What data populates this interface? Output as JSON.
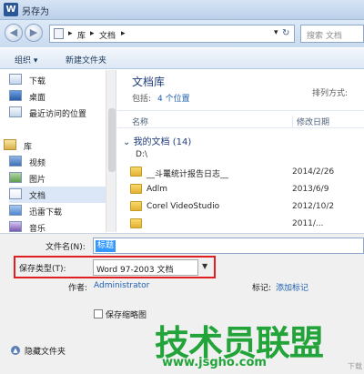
{
  "window": {
    "title": "另存为",
    "app_icon_letter": "W"
  },
  "nav": {
    "back_glyph": "◀",
    "forward_glyph": "▶",
    "breadcrumbs": [
      "库",
      "文档"
    ],
    "refresh_glyph": "↻",
    "search_placeholder": "搜索 文档"
  },
  "toolbar": {
    "organize_label": "组织 ▾",
    "new_folder_label": "新建文件夹"
  },
  "sidebar": {
    "items": [
      {
        "label": "下载",
        "icon": "download-icon"
      },
      {
        "label": "桌面",
        "icon": "desktop-icon"
      },
      {
        "label": "最近访问的位置",
        "icon": "recent-icon"
      },
      {
        "label": "库",
        "icon": "library-icon"
      },
      {
        "label": "视频",
        "icon": "video-icon"
      },
      {
        "label": "图片",
        "icon": "picture-icon"
      },
      {
        "label": "文档",
        "icon": "documents-icon",
        "selected": true
      },
      {
        "label": "迅雷下载",
        "icon": "thunder-icon"
      },
      {
        "label": "音乐",
        "icon": "music-icon"
      }
    ]
  },
  "library": {
    "title": "文档库",
    "includes_label": "包括:",
    "includes_link": "4 个位置",
    "arrange_label": "排列方式:"
  },
  "columns": {
    "name": "名称",
    "date": "修改日期"
  },
  "group": {
    "header": "我的文档 (14)",
    "path": "D:\\"
  },
  "files": [
    {
      "name": "__斗鼍统计报告日志__",
      "date": "2014/2/26"
    },
    {
      "name": "Adlm",
      "date": "2013/6/9"
    },
    {
      "name": "Corel VideoStudio",
      "date": "2012/10/2"
    },
    {
      "name": "",
      "date": "2011/..."
    }
  ],
  "save": {
    "filename_label": "文件名(N):",
    "filename_value": "标题",
    "filetype_label": "保存类型(T):",
    "filetype_value": "Word 97-2003 文档",
    "author_label": "作者:",
    "author_value": "Administrator",
    "tags_label": "标记:",
    "tags_value": "添加标记",
    "thumbnail_label": "保存缩略图",
    "hide_folders_label": "隐藏文件夹"
  },
  "watermark": {
    "main": "技术员联盟",
    "site": "www.jsgho.com",
    "corner": "下载"
  },
  "colors": {
    "selection": "#3399ff",
    "highlight_box": "#e02020",
    "link": "#1f5fb0",
    "watermark": "#23a43a"
  }
}
